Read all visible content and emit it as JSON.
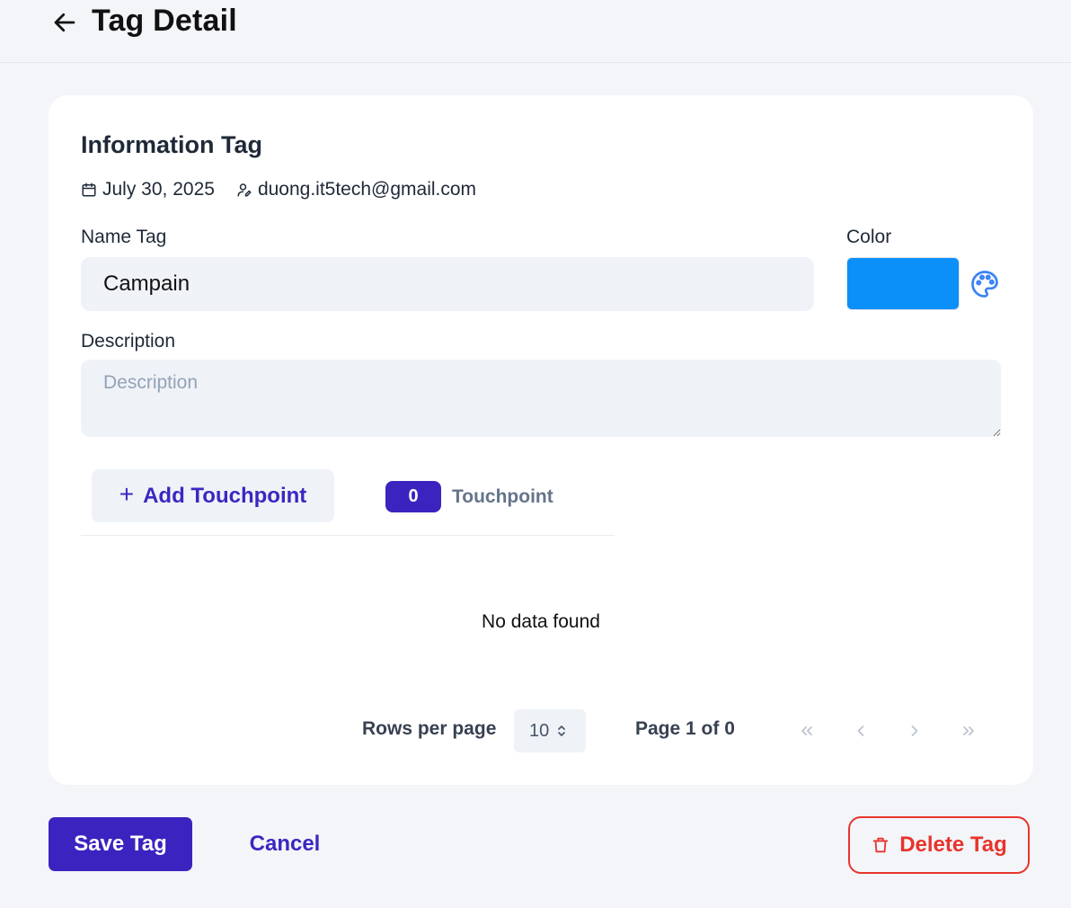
{
  "header": {
    "title": "Tag Detail"
  },
  "info": {
    "section_title": "Information Tag",
    "date": "July 30, 2025",
    "email": "duong.it5tech@gmail.com"
  },
  "form": {
    "name_label": "Name Tag",
    "name_value": "Campain",
    "color_label": "Color",
    "color_value": "#0b8ff9",
    "description_label": "Description",
    "description_placeholder": "Description"
  },
  "touchpoints": {
    "add_label": "Add Touchpoint",
    "count": "0",
    "tab_label": "Touchpoint",
    "empty_text": "No data found"
  },
  "pagination": {
    "rows_label": "Rows per page",
    "rows_value": "10",
    "page_info": "Page 1 of 0"
  },
  "actions": {
    "save_label": "Save Tag",
    "cancel_label": "Cancel",
    "delete_label": "Delete Tag"
  },
  "colors": {
    "primary": "#3b23c0",
    "danger": "#e8342c",
    "palette_icon": "#3b82f6"
  }
}
